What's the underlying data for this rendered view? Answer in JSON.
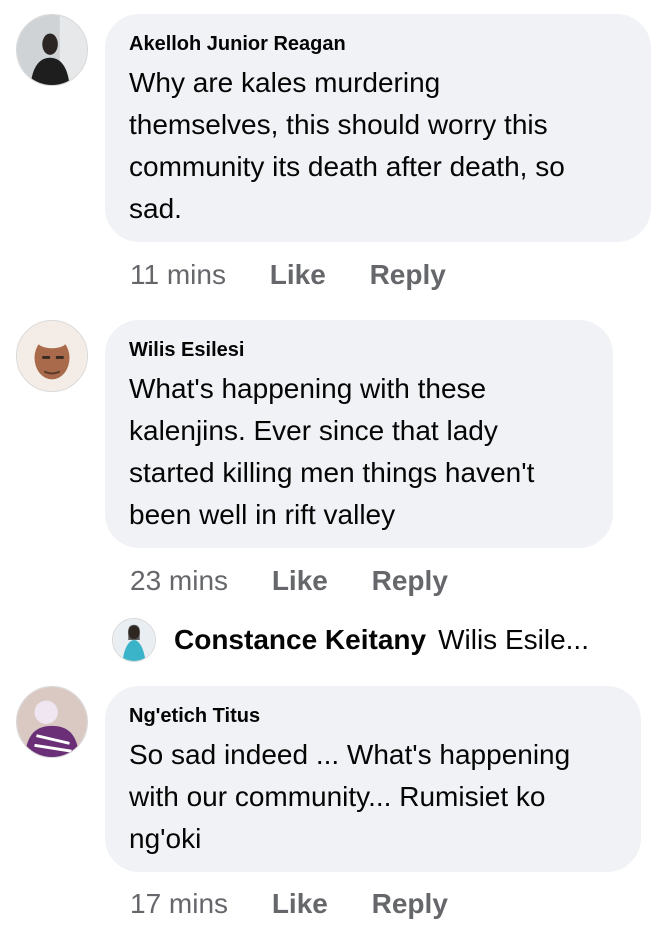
{
  "comments": [
    {
      "author": "Akelloh Junior Reagan",
      "text": "Why are kales murdering\nthemselves, this should worry this\ncommunity its death after death, so\nsad.",
      "time": "11 mins",
      "like_label": "Like",
      "reply_label": "Reply",
      "avatar_icon": "man-portrait-dark-icon"
    },
    {
      "author": "Wilis Esilesi",
      "text": "What's happening with these\nkalenjins. Ever since that lady\nstarted killing men things haven't\nbeen well in rift valley",
      "time": "23 mins",
      "like_label": "Like",
      "reply_label": "Reply",
      "avatar_icon": "man-selfie-icon"
    },
    {
      "author": "Ng'etich Titus",
      "text": "So sad indeed ... What's happening\nwith our community... Rumisiet ko\nng'oki",
      "time": "17 mins",
      "like_label": "Like",
      "reply_label": "Reply",
      "avatar_icon": "person-purple-icon"
    }
  ],
  "reply_preview": {
    "author": "Constance Keitany",
    "snippet": "Wilis Esile...",
    "avatar_icon": "woman-portrait-icon"
  },
  "colors": {
    "bubble": "#f0f2f5",
    "meta_text": "#65676b",
    "text": "#050505"
  }
}
